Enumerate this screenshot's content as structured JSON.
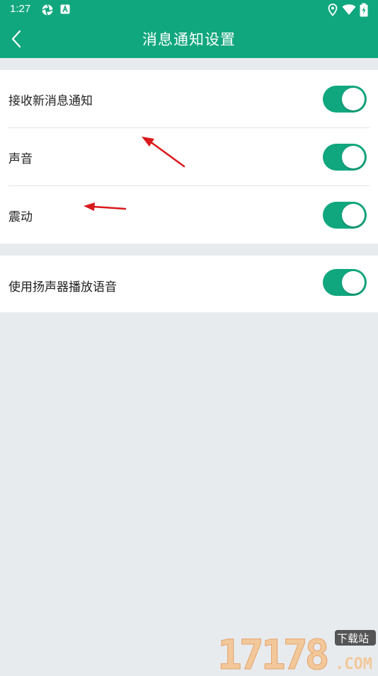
{
  "status_bar": {
    "time": "1:27",
    "icons": [
      "camera-aperture-icon",
      "notification-a-icon",
      "location-icon",
      "wifi-icon",
      "battery-charging-icon"
    ]
  },
  "app_bar": {
    "title": "消息通知设置",
    "back_icon": "chevron-left-icon"
  },
  "settings": {
    "group1": [
      {
        "label": "接收新消息通知",
        "enabled": true
      },
      {
        "label": "声音",
        "enabled": true
      },
      {
        "label": "震动",
        "enabled": true
      }
    ],
    "group2": [
      {
        "label": "使用扬声器播放语音",
        "enabled": true
      }
    ]
  },
  "colors": {
    "accent": "#11a77e",
    "background": "#e8ebee",
    "annotation_arrow": "#d9191c"
  },
  "watermark": {
    "digits": "17178",
    "badge": "下载站",
    "suffix": ".COM"
  }
}
